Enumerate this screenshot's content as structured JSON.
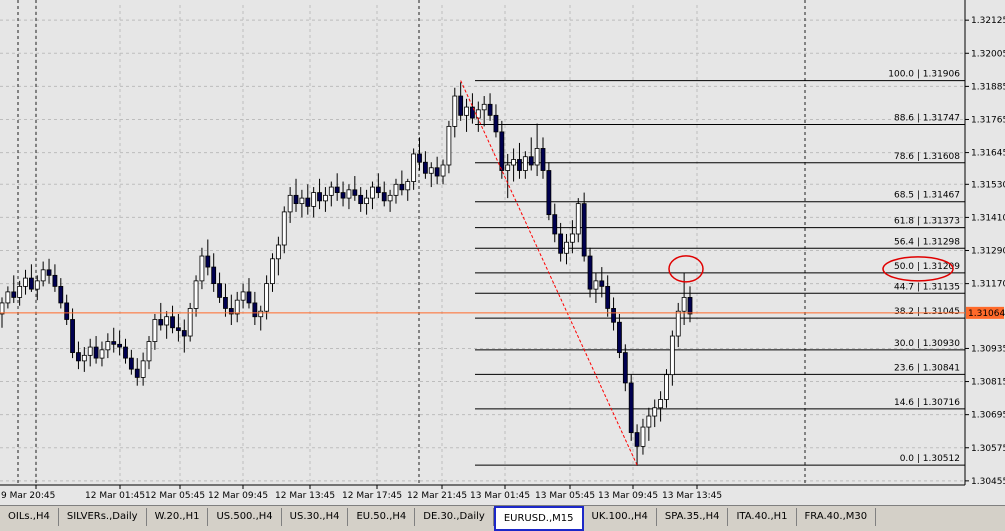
{
  "chart": {
    "symbol_tab": "EURUSD.,M15",
    "colors": {
      "background": "#e6e6e6",
      "grid": "#bdbdbd",
      "candle_up": "#ffffff",
      "candle_down": "#000050",
      "current_price": "#ff6a2a",
      "fib_line": "#000000",
      "fib_trend": "#ff0000",
      "highlight": "#e00000"
    }
  },
  "chart_data": {
    "type": "candlestick",
    "price_axis_labels": [
      "1.32125",
      "1.32005",
      "1.31885",
      "1.31765",
      "1.31645",
      "1.31530",
      "1.31410",
      "1.31290",
      "1.31170",
      "1.31064",
      "1.30935",
      "1.30815",
      "1.30695",
      "1.30575",
      "1.30455"
    ],
    "ylim": [
      1.3044,
      1.3218
    ],
    "time_axis_labels": [
      "9 Mar 20:45",
      "12 Mar 01:45",
      "12 Mar 05:45",
      "12 Mar 09:45",
      "12 Mar 13:45",
      "12 Mar 17:45",
      "12 Mar 21:45",
      "13 Mar 01:45",
      "13 Mar 05:45",
      "13 Mar 09:45",
      "13 Mar 13:45"
    ],
    "current_price": 1.31064,
    "fibonacci": [
      {
        "label": "100.0 | 1.31906",
        "price": 1.31906
      },
      {
        "label": "88.6 | 1.31747",
        "price": 1.31747
      },
      {
        "label": "78.6 | 1.31608",
        "price": 1.31608
      },
      {
        "label": "68.5 | 1.31467",
        "price": 1.31467
      },
      {
        "label": "61.8 | 1.31373",
        "price": 1.31373
      },
      {
        "label": "56.4 | 1.31298",
        "price": 1.31298
      },
      {
        "label": "50.0 | 1.31209",
        "price": 1.31209
      },
      {
        "label": "44.7 | 1.31135",
        "price": 1.31135
      },
      {
        "label": "38.2 | 1.31045",
        "price": 1.31045
      },
      {
        "label": "30.0 | 1.30930",
        "price": 1.3093
      },
      {
        "label": "23.6 | 1.30841",
        "price": 1.30841
      },
      {
        "label": "14.6 | 1.30716",
        "price": 1.30716
      },
      {
        "label": "0.0 | 1.30512",
        "price": 1.30512
      }
    ],
    "highlighted_level": "50.0 | 1.31209",
    "candles": [
      [
        1.3106,
        1.3112,
        1.3101,
        1.311
      ],
      [
        1.311,
        1.3116,
        1.3108,
        1.3114
      ],
      [
        1.3114,
        1.312,
        1.311,
        1.3112
      ],
      [
        1.3112,
        1.3118,
        1.3109,
        1.3116
      ],
      [
        1.3116,
        1.3122,
        1.3113,
        1.3119
      ],
      [
        1.3119,
        1.3124,
        1.3114,
        1.3115
      ],
      [
        1.3115,
        1.312,
        1.3111,
        1.3118
      ],
      [
        1.3118,
        1.3125,
        1.3116,
        1.3122
      ],
      [
        1.3122,
        1.3126,
        1.3117,
        1.312
      ],
      [
        1.312,
        1.3124,
        1.3114,
        1.3116
      ],
      [
        1.3116,
        1.3119,
        1.3108,
        1.311
      ],
      [
        1.311,
        1.3113,
        1.3102,
        1.3104
      ],
      [
        1.3104,
        1.3108,
        1.309,
        1.3092
      ],
      [
        1.3092,
        1.3096,
        1.3086,
        1.3089
      ],
      [
        1.3089,
        1.3094,
        1.3085,
        1.3091
      ],
      [
        1.3091,
        1.3097,
        1.3087,
        1.3094
      ],
      [
        1.3094,
        1.3098,
        1.3088,
        1.309
      ],
      [
        1.309,
        1.3096,
        1.3087,
        1.3093
      ],
      [
        1.3093,
        1.3099,
        1.309,
        1.3096
      ],
      [
        1.3096,
        1.3101,
        1.3092,
        1.3095
      ],
      [
        1.3095,
        1.31,
        1.3091,
        1.3094
      ],
      [
        1.3094,
        1.3097,
        1.3088,
        1.309
      ],
      [
        1.309,
        1.3093,
        1.3084,
        1.3086
      ],
      [
        1.3086,
        1.309,
        1.308,
        1.3083
      ],
      [
        1.3083,
        1.3092,
        1.308,
        1.3089
      ],
      [
        1.3089,
        1.3098,
        1.3086,
        1.3096
      ],
      [
        1.3096,
        1.3106,
        1.3093,
        1.3104
      ],
      [
        1.3104,
        1.311,
        1.31,
        1.3102
      ],
      [
        1.3102,
        1.3107,
        1.3097,
        1.3105
      ],
      [
        1.3105,
        1.3109,
        1.3099,
        1.3101
      ],
      [
        1.3101,
        1.3106,
        1.3096,
        1.31
      ],
      [
        1.31,
        1.3104,
        1.3092,
        1.3098
      ],
      [
        1.3098,
        1.311,
        1.3096,
        1.3108
      ],
      [
        1.3108,
        1.312,
        1.3105,
        1.3118
      ],
      [
        1.3118,
        1.313,
        1.3115,
        1.3127
      ],
      [
        1.3127,
        1.3133,
        1.312,
        1.3123
      ],
      [
        1.3123,
        1.3128,
        1.3114,
        1.3117
      ],
      [
        1.3117,
        1.3121,
        1.311,
        1.3112
      ],
      [
        1.3112,
        1.3117,
        1.3105,
        1.3108
      ],
      [
        1.3108,
        1.3113,
        1.3102,
        1.3106
      ],
      [
        1.3106,
        1.3114,
        1.3103,
        1.3111
      ],
      [
        1.3111,
        1.3117,
        1.3108,
        1.3114
      ],
      [
        1.3114,
        1.3119,
        1.3108,
        1.311
      ],
      [
        1.311,
        1.3114,
        1.3102,
        1.3105
      ],
      [
        1.3105,
        1.3109,
        1.31,
        1.3107
      ],
      [
        1.3107,
        1.312,
        1.3104,
        1.3117
      ],
      [
        1.3117,
        1.3128,
        1.3114,
        1.3126
      ],
      [
        1.3126,
        1.3134,
        1.312,
        1.3131
      ],
      [
        1.3131,
        1.3145,
        1.3128,
        1.3143
      ],
      [
        1.3143,
        1.3152,
        1.3139,
        1.3149
      ],
      [
        1.3149,
        1.3155,
        1.3143,
        1.3146
      ],
      [
        1.3146,
        1.3151,
        1.3141,
        1.3148
      ],
      [
        1.3148,
        1.3153,
        1.3142,
        1.3145
      ],
      [
        1.3145,
        1.3152,
        1.3141,
        1.315
      ],
      [
        1.315,
        1.3155,
        1.3144,
        1.3147
      ],
      [
        1.3147,
        1.3152,
        1.3143,
        1.3149
      ],
      [
        1.3149,
        1.3154,
        1.3145,
        1.3152
      ],
      [
        1.3152,
        1.3157,
        1.3147,
        1.315
      ],
      [
        1.315,
        1.3154,
        1.3145,
        1.3148
      ],
      [
        1.3148,
        1.3153,
        1.3144,
        1.3151
      ],
      [
        1.3151,
        1.3156,
        1.3147,
        1.3149
      ],
      [
        1.3149,
        1.3152,
        1.3143,
        1.3146
      ],
      [
        1.3146,
        1.3151,
        1.3142,
        1.3148
      ],
      [
        1.3148,
        1.3154,
        1.3144,
        1.3152
      ],
      [
        1.3152,
        1.3157,
        1.3148,
        1.315
      ],
      [
        1.315,
        1.3154,
        1.3145,
        1.3147
      ],
      [
        1.3147,
        1.3151,
        1.3143,
        1.3149
      ],
      [
        1.3149,
        1.3155,
        1.3146,
        1.3153
      ],
      [
        1.3153,
        1.3158,
        1.3149,
        1.3151
      ],
      [
        1.3151,
        1.3155,
        1.3147,
        1.3154
      ],
      [
        1.3154,
        1.3166,
        1.3151,
        1.3164
      ],
      [
        1.3164,
        1.317,
        1.3158,
        1.3161
      ],
      [
        1.3161,
        1.3165,
        1.3155,
        1.3157
      ],
      [
        1.3157,
        1.3161,
        1.3152,
        1.3159
      ],
      [
        1.3159,
        1.3163,
        1.3153,
        1.3156
      ],
      [
        1.3156,
        1.3162,
        1.3153,
        1.316
      ],
      [
        1.316,
        1.3176,
        1.3157,
        1.3174
      ],
      [
        1.3174,
        1.3188,
        1.317,
        1.3185
      ],
      [
        1.3185,
        1.319,
        1.3176,
        1.3178
      ],
      [
        1.3178,
        1.3184,
        1.3172,
        1.3181
      ],
      [
        1.3181,
        1.3186,
        1.3175,
        1.3177
      ],
      [
        1.3177,
        1.3183,
        1.3172,
        1.318
      ],
      [
        1.318,
        1.3185,
        1.3174,
        1.3182
      ],
      [
        1.3182,
        1.3186,
        1.3176,
        1.3178
      ],
      [
        1.3178,
        1.3182,
        1.317,
        1.3172
      ],
      [
        1.3172,
        1.3176,
        1.3155,
        1.3158
      ],
      [
        1.3158,
        1.3164,
        1.3148,
        1.316
      ],
      [
        1.316,
        1.3166,
        1.3154,
        1.3162
      ],
      [
        1.3162,
        1.3168,
        1.3155,
        1.3158
      ],
      [
        1.3158,
        1.3165,
        1.3155,
        1.3163
      ],
      [
        1.3163,
        1.317,
        1.3158,
        1.316
      ],
      [
        1.316,
        1.3175,
        1.3156,
        1.3166
      ],
      [
        1.3166,
        1.317,
        1.3155,
        1.3158
      ],
      [
        1.3158,
        1.3161,
        1.314,
        1.3142
      ],
      [
        1.3142,
        1.3146,
        1.3132,
        1.3135
      ],
      [
        1.3135,
        1.3139,
        1.3125,
        1.3128
      ],
      [
        1.3128,
        1.3135,
        1.3124,
        1.3132
      ],
      [
        1.3132,
        1.314,
        1.3128,
        1.3135
      ],
      [
        1.3135,
        1.3148,
        1.3132,
        1.3146
      ],
      [
        1.3146,
        1.315,
        1.3125,
        1.3127
      ],
      [
        1.3127,
        1.313,
        1.3112,
        1.3115
      ],
      [
        1.3115,
        1.3121,
        1.311,
        1.3118
      ],
      [
        1.3118,
        1.3123,
        1.3112,
        1.3116
      ],
      [
        1.3116,
        1.312,
        1.3105,
        1.3108
      ],
      [
        1.3108,
        1.3112,
        1.31,
        1.3103
      ],
      [
        1.3103,
        1.3106,
        1.309,
        1.3092
      ],
      [
        1.3092,
        1.3095,
        1.3078,
        1.3081
      ],
      [
        1.3081,
        1.3084,
        1.306,
        1.3063
      ],
      [
        1.3063,
        1.3066,
        1.3051,
        1.3058
      ],
      [
        1.3058,
        1.3068,
        1.3055,
        1.3065
      ],
      [
        1.3065,
        1.3072,
        1.306,
        1.3069
      ],
      [
        1.3069,
        1.3075,
        1.3065,
        1.3072
      ],
      [
        1.3072,
        1.3078,
        1.3067,
        1.3075
      ],
      [
        1.3075,
        1.3086,
        1.3072,
        1.3084
      ],
      [
        1.3084,
        1.31,
        1.308,
        1.3098
      ],
      [
        1.3098,
        1.311,
        1.3094,
        1.3107
      ],
      [
        1.3107,
        1.3121,
        1.3102,
        1.3112
      ],
      [
        1.3112,
        1.3116,
        1.3103,
        1.3106
      ]
    ]
  },
  "tabs": [
    {
      "label": "OILs.,H4"
    },
    {
      "label": "SILVERs.,Daily"
    },
    {
      "label": "W.20.,H1"
    },
    {
      "label": "US.500.,H4"
    },
    {
      "label": "US.30.,H4"
    },
    {
      "label": "EU.50.,H4"
    },
    {
      "label": "DE.30.,Daily"
    },
    {
      "label": "EURUSD.,M15",
      "active": true
    },
    {
      "label": "UK.100.,H4"
    },
    {
      "label": "SPA.35.,H4"
    },
    {
      "label": "ITA.40.,H1"
    },
    {
      "label": "FRA.40.,M30"
    }
  ]
}
